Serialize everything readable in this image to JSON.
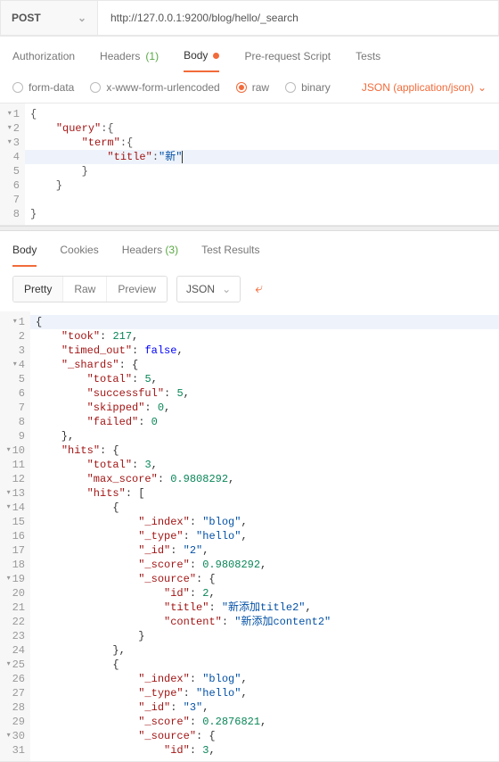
{
  "request": {
    "method": "POST",
    "url": "http://127.0.0.1:9200/blog/hello/_search",
    "tabs": {
      "authorization": "Authorization",
      "headers": "Headers",
      "headers_count": "(1)",
      "body": "Body",
      "prerequest": "Pre-request Script",
      "tests": "Tests"
    },
    "bodytypes": {
      "formdata": "form-data",
      "xwww": "x-www-form-urlencoded",
      "raw": "raw",
      "binary": "binary"
    },
    "content_type": "JSON (application/json)",
    "code_lines": [
      {
        "n": "1",
        "fold": "▾",
        "t": "{",
        "hl": false
      },
      {
        "n": "2",
        "fold": "▾",
        "t": "    \"query\":{",
        "hl": false
      },
      {
        "n": "3",
        "fold": "▾",
        "t": "        \"term\":{",
        "hl": false
      },
      {
        "n": "4",
        "fold": "",
        "t": "            \"title\":\"新\"",
        "hl": true,
        "cursor": true
      },
      {
        "n": "5",
        "fold": "",
        "t": "        }",
        "hl": false
      },
      {
        "n": "6",
        "fold": "",
        "t": "    }",
        "hl": false
      },
      {
        "n": "7",
        "fold": "",
        "t": "",
        "hl": false
      },
      {
        "n": "8",
        "fold": "",
        "t": "}",
        "hl": false
      }
    ]
  },
  "response": {
    "tabs": {
      "body": "Body",
      "cookies": "Cookies",
      "headers": "Headers",
      "headers_count": "(3)",
      "tests": "Test Results"
    },
    "viewmodes": {
      "pretty": "Pretty",
      "raw": "Raw",
      "preview": "Preview"
    },
    "format": "JSON",
    "code_lines": [
      {
        "n": "1",
        "fold": "▾",
        "first": true,
        "segs": [
          {
            "t": "{",
            "c": "p"
          }
        ]
      },
      {
        "n": "2",
        "fold": "",
        "segs": [
          {
            "t": "    ",
            "c": "p"
          },
          {
            "t": "\"took\"",
            "c": "k"
          },
          {
            "t": ": ",
            "c": "p"
          },
          {
            "t": "217",
            "c": "n"
          },
          {
            "t": ",",
            "c": "p"
          }
        ]
      },
      {
        "n": "3",
        "fold": "",
        "segs": [
          {
            "t": "    ",
            "c": "p"
          },
          {
            "t": "\"timed_out\"",
            "c": "k"
          },
          {
            "t": ": ",
            "c": "p"
          },
          {
            "t": "false",
            "c": "b"
          },
          {
            "t": ",",
            "c": "p"
          }
        ]
      },
      {
        "n": "4",
        "fold": "▾",
        "segs": [
          {
            "t": "    ",
            "c": "p"
          },
          {
            "t": "\"_shards\"",
            "c": "k"
          },
          {
            "t": ": {",
            "c": "p"
          }
        ]
      },
      {
        "n": "5",
        "fold": "",
        "segs": [
          {
            "t": "        ",
            "c": "p"
          },
          {
            "t": "\"total\"",
            "c": "k"
          },
          {
            "t": ": ",
            "c": "p"
          },
          {
            "t": "5",
            "c": "n"
          },
          {
            "t": ",",
            "c": "p"
          }
        ]
      },
      {
        "n": "6",
        "fold": "",
        "segs": [
          {
            "t": "        ",
            "c": "p"
          },
          {
            "t": "\"successful\"",
            "c": "k"
          },
          {
            "t": ": ",
            "c": "p"
          },
          {
            "t": "5",
            "c": "n"
          },
          {
            "t": ",",
            "c": "p"
          }
        ]
      },
      {
        "n": "7",
        "fold": "",
        "segs": [
          {
            "t": "        ",
            "c": "p"
          },
          {
            "t": "\"skipped\"",
            "c": "k"
          },
          {
            "t": ": ",
            "c": "p"
          },
          {
            "t": "0",
            "c": "n"
          },
          {
            "t": ",",
            "c": "p"
          }
        ]
      },
      {
        "n": "8",
        "fold": "",
        "segs": [
          {
            "t": "        ",
            "c": "p"
          },
          {
            "t": "\"failed\"",
            "c": "k"
          },
          {
            "t": ": ",
            "c": "p"
          },
          {
            "t": "0",
            "c": "n"
          }
        ]
      },
      {
        "n": "9",
        "fold": "",
        "segs": [
          {
            "t": "    },",
            "c": "p"
          }
        ]
      },
      {
        "n": "10",
        "fold": "▾",
        "segs": [
          {
            "t": "    ",
            "c": "p"
          },
          {
            "t": "\"hits\"",
            "c": "k"
          },
          {
            "t": ": {",
            "c": "p"
          }
        ]
      },
      {
        "n": "11",
        "fold": "",
        "segs": [
          {
            "t": "        ",
            "c": "p"
          },
          {
            "t": "\"total\"",
            "c": "k"
          },
          {
            "t": ": ",
            "c": "p"
          },
          {
            "t": "3",
            "c": "n"
          },
          {
            "t": ",",
            "c": "p"
          }
        ]
      },
      {
        "n": "12",
        "fold": "",
        "segs": [
          {
            "t": "        ",
            "c": "p"
          },
          {
            "t": "\"max_score\"",
            "c": "k"
          },
          {
            "t": ": ",
            "c": "p"
          },
          {
            "t": "0.9808292",
            "c": "n"
          },
          {
            "t": ",",
            "c": "p"
          }
        ]
      },
      {
        "n": "13",
        "fold": "▾",
        "segs": [
          {
            "t": "        ",
            "c": "p"
          },
          {
            "t": "\"hits\"",
            "c": "k"
          },
          {
            "t": ": [",
            "c": "p"
          }
        ]
      },
      {
        "n": "14",
        "fold": "▾",
        "segs": [
          {
            "t": "            {",
            "c": "p"
          }
        ]
      },
      {
        "n": "15",
        "fold": "",
        "segs": [
          {
            "t": "                ",
            "c": "p"
          },
          {
            "t": "\"_index\"",
            "c": "k"
          },
          {
            "t": ": ",
            "c": "p"
          },
          {
            "t": "\"blog\"",
            "c": "s"
          },
          {
            "t": ",",
            "c": "p"
          }
        ]
      },
      {
        "n": "16",
        "fold": "",
        "segs": [
          {
            "t": "                ",
            "c": "p"
          },
          {
            "t": "\"_type\"",
            "c": "k"
          },
          {
            "t": ": ",
            "c": "p"
          },
          {
            "t": "\"hello\"",
            "c": "s"
          },
          {
            "t": ",",
            "c": "p"
          }
        ]
      },
      {
        "n": "17",
        "fold": "",
        "segs": [
          {
            "t": "                ",
            "c": "p"
          },
          {
            "t": "\"_id\"",
            "c": "k"
          },
          {
            "t": ": ",
            "c": "p"
          },
          {
            "t": "\"2\"",
            "c": "s"
          },
          {
            "t": ",",
            "c": "p"
          }
        ]
      },
      {
        "n": "18",
        "fold": "",
        "segs": [
          {
            "t": "                ",
            "c": "p"
          },
          {
            "t": "\"_score\"",
            "c": "k"
          },
          {
            "t": ": ",
            "c": "p"
          },
          {
            "t": "0.9808292",
            "c": "n"
          },
          {
            "t": ",",
            "c": "p"
          }
        ]
      },
      {
        "n": "19",
        "fold": "▾",
        "segs": [
          {
            "t": "                ",
            "c": "p"
          },
          {
            "t": "\"_source\"",
            "c": "k"
          },
          {
            "t": ": {",
            "c": "p"
          }
        ]
      },
      {
        "n": "20",
        "fold": "",
        "segs": [
          {
            "t": "                    ",
            "c": "p"
          },
          {
            "t": "\"id\"",
            "c": "k"
          },
          {
            "t": ": ",
            "c": "p"
          },
          {
            "t": "2",
            "c": "n"
          },
          {
            "t": ",",
            "c": "p"
          }
        ]
      },
      {
        "n": "21",
        "fold": "",
        "segs": [
          {
            "t": "                    ",
            "c": "p"
          },
          {
            "t": "\"title\"",
            "c": "k"
          },
          {
            "t": ": ",
            "c": "p"
          },
          {
            "t": "\"新添加title2\"",
            "c": "s"
          },
          {
            "t": ",",
            "c": "p"
          }
        ]
      },
      {
        "n": "22",
        "fold": "",
        "segs": [
          {
            "t": "                    ",
            "c": "p"
          },
          {
            "t": "\"content\"",
            "c": "k"
          },
          {
            "t": ": ",
            "c": "p"
          },
          {
            "t": "\"新添加content2\"",
            "c": "s"
          }
        ]
      },
      {
        "n": "23",
        "fold": "",
        "segs": [
          {
            "t": "                }",
            "c": "p"
          }
        ]
      },
      {
        "n": "24",
        "fold": "",
        "segs": [
          {
            "t": "            },",
            "c": "p"
          }
        ]
      },
      {
        "n": "25",
        "fold": "▾",
        "segs": [
          {
            "t": "            {",
            "c": "p"
          }
        ]
      },
      {
        "n": "26",
        "fold": "",
        "segs": [
          {
            "t": "                ",
            "c": "p"
          },
          {
            "t": "\"_index\"",
            "c": "k"
          },
          {
            "t": ": ",
            "c": "p"
          },
          {
            "t": "\"blog\"",
            "c": "s"
          },
          {
            "t": ",",
            "c": "p"
          }
        ]
      },
      {
        "n": "27",
        "fold": "",
        "segs": [
          {
            "t": "                ",
            "c": "p"
          },
          {
            "t": "\"_type\"",
            "c": "k"
          },
          {
            "t": ": ",
            "c": "p"
          },
          {
            "t": "\"hello\"",
            "c": "s"
          },
          {
            "t": ",",
            "c": "p"
          }
        ]
      },
      {
        "n": "28",
        "fold": "",
        "segs": [
          {
            "t": "                ",
            "c": "p"
          },
          {
            "t": "\"_id\"",
            "c": "k"
          },
          {
            "t": ": ",
            "c": "p"
          },
          {
            "t": "\"3\"",
            "c": "s"
          },
          {
            "t": ",",
            "c": "p"
          }
        ]
      },
      {
        "n": "29",
        "fold": "",
        "segs": [
          {
            "t": "                ",
            "c": "p"
          },
          {
            "t": "\"_score\"",
            "c": "k"
          },
          {
            "t": ": ",
            "c": "p"
          },
          {
            "t": "0.2876821",
            "c": "n"
          },
          {
            "t": ",",
            "c": "p"
          }
        ]
      },
      {
        "n": "30",
        "fold": "▾",
        "segs": [
          {
            "t": "                ",
            "c": "p"
          },
          {
            "t": "\"_source\"",
            "c": "k"
          },
          {
            "t": ": {",
            "c": "p"
          }
        ]
      },
      {
        "n": "31",
        "fold": "",
        "segs": [
          {
            "t": "                    ",
            "c": "p"
          },
          {
            "t": "\"id\"",
            "c": "k"
          },
          {
            "t": ": ",
            "c": "p"
          },
          {
            "t": "3",
            "c": "n"
          },
          {
            "t": ",",
            "c": "p"
          }
        ]
      }
    ]
  }
}
